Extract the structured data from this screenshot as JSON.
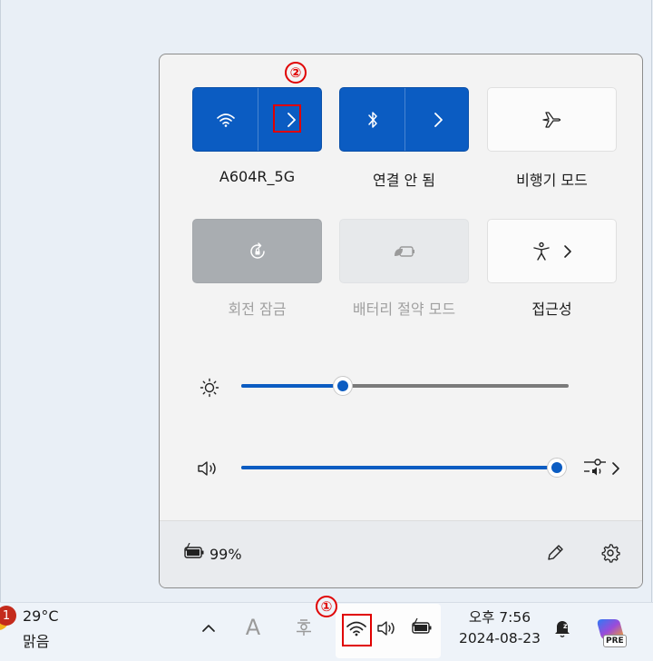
{
  "quick_settings": {
    "tiles": [
      {
        "label": "A604R_5G",
        "icon": "wifi-icon",
        "state": "on",
        "expandable": true
      },
      {
        "label": "연결 안 됨",
        "icon": "bluetooth-icon",
        "state": "on",
        "expandable": true
      },
      {
        "label": "비행기 모드",
        "icon": "airplane-icon",
        "state": "off"
      },
      {
        "label": "회전 잠금",
        "icon": "rotation-lock-icon",
        "state": "disabled"
      },
      {
        "label": "배터리 절약 모드",
        "icon": "battery-saver-icon",
        "state": "disabled"
      },
      {
        "label": "접근성",
        "icon": "accessibility-icon",
        "state": "off",
        "expandable": true
      }
    ],
    "brightness": {
      "value": 0.31
    },
    "volume": {
      "value": 1.0
    },
    "battery_percent": "99%"
  },
  "annotations": {
    "marker_1": "①",
    "marker_2": "②"
  },
  "taskbar": {
    "weather": {
      "badge": "1",
      "temperature": "29°C",
      "condition": "맑음"
    },
    "ime_letter": "A",
    "time": "오후 7:56",
    "date": "2024-08-23",
    "copilot_badge": "PRE"
  },
  "colors": {
    "accent": "#0b5cc2",
    "annotation_red": "#e00000"
  }
}
